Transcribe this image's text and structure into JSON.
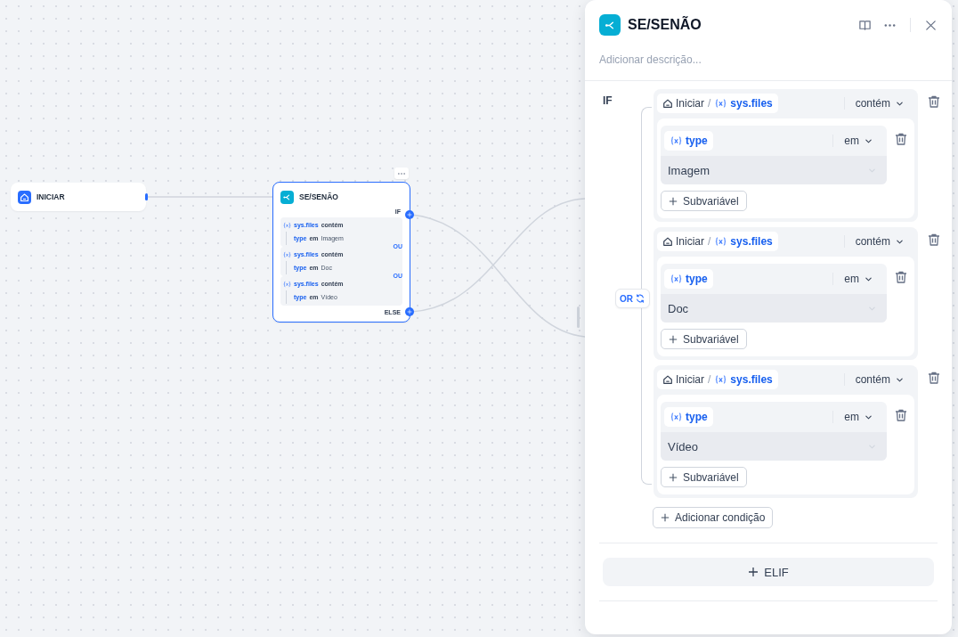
{
  "canvas": {
    "start_node": {
      "title": "INICIAR"
    },
    "ifelse_node": {
      "title": "SE/SENÃO",
      "selected": true,
      "if_label": "IF",
      "else_label": "ELSE",
      "conditions": [
        {
          "variable": "sys.files",
          "operator": "contém",
          "sub_variable": "type",
          "sub_operator": "em",
          "sub_value": "Imagem"
        },
        {
          "connector": "OU",
          "variable": "sys.files",
          "operator": "contém",
          "sub_variable": "type",
          "sub_operator": "em",
          "sub_value": "Doc"
        },
        {
          "connector": "OU",
          "variable": "sys.files",
          "operator": "contém",
          "sub_variable": "type",
          "sub_operator": "em",
          "sub_value": "Vídeo"
        }
      ]
    }
  },
  "panel": {
    "title": "SE/SENÃO",
    "description_placeholder": "Adicionar descrição...",
    "if_label": "IF",
    "logical_operator": "OR",
    "conditions": [
      {
        "source": "Iniciar",
        "separator": "/",
        "variable": "sys.files",
        "operator": "contém",
        "sub_conditions": [
          {
            "variable": "type",
            "operator": "em",
            "value": "Imagem"
          }
        ],
        "add_sub_label": "Subvariável"
      },
      {
        "source": "Iniciar",
        "separator": "/",
        "variable": "sys.files",
        "operator": "contém",
        "sub_conditions": [
          {
            "variable": "type",
            "operator": "em",
            "value": "Doc"
          }
        ],
        "add_sub_label": "Subvariável"
      },
      {
        "source": "Iniciar",
        "separator": "/",
        "variable": "sys.files",
        "operator": "contém",
        "sub_conditions": [
          {
            "variable": "type",
            "operator": "em",
            "value": "Vídeo"
          }
        ],
        "add_sub_label": "Subvariável"
      }
    ],
    "add_condition_label": "Adicionar condição",
    "elif_label": "ELIF"
  }
}
